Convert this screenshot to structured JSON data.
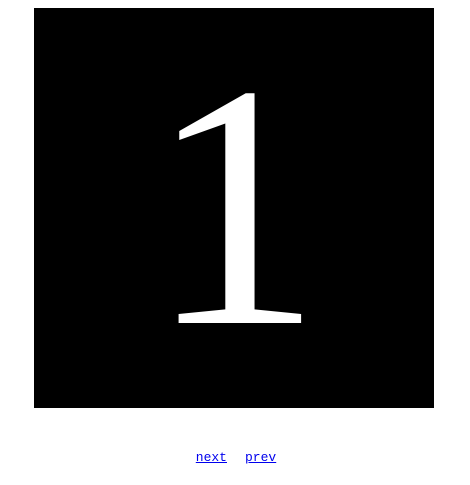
{
  "slide": {
    "number": "1"
  },
  "pager": {
    "next_label": "next",
    "prev_label": "prev"
  },
  "colors": {
    "slide_background": "#000000",
    "slide_text": "#ffffff",
    "link": "#0000ee"
  }
}
